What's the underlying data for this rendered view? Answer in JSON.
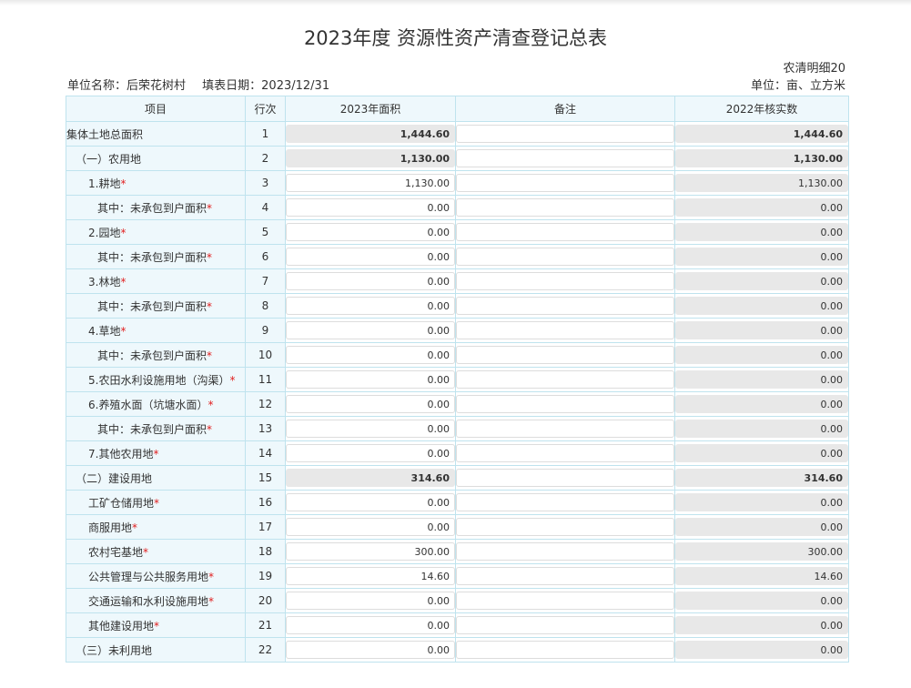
{
  "title": "2023年度 资源性资产清查登记总表",
  "meta": {
    "code": "农清明细20",
    "unit_name": "单位名称：后荣花树村",
    "fill_date": "填表日期：2023/12/31",
    "unit_measure": "单位：亩、立方米"
  },
  "headers": [
    "项目",
    "行次",
    "2023年面积",
    "备注",
    "2022年核实数"
  ],
  "rows": [
    {
      "item": "集体土地总面积",
      "req": "",
      "row": "1",
      "current": "1,444.60",
      "note": "",
      "prev": "1,444.60"
    },
    {
      "item": "（一）农用地",
      "req": "",
      "row": "2",
      "current": "1,130.00",
      "note": "",
      "prev": "1,130.00"
    },
    {
      "item": "1.耕地",
      "req": "*",
      "row": "3",
      "current": "1,130.00",
      "note": "",
      "prev": "1,130.00"
    },
    {
      "item": "其中：未承包到户面积",
      "req": "*",
      "row": "4",
      "current": "0.00",
      "note": "",
      "prev": "0.00"
    },
    {
      "item": "2.园地",
      "req": "*",
      "row": "5",
      "current": "0.00",
      "note": "",
      "prev": "0.00"
    },
    {
      "item": "其中：未承包到户面积",
      "req": "*",
      "row": "6",
      "current": "0.00",
      "note": "",
      "prev": "0.00"
    },
    {
      "item": "3.林地",
      "req": "*",
      "row": "7",
      "current": "0.00",
      "note": "",
      "prev": "0.00"
    },
    {
      "item": "其中：未承包到户面积",
      "req": "*",
      "row": "8",
      "current": "0.00",
      "note": "",
      "prev": "0.00"
    },
    {
      "item": "4.草地",
      "req": "*",
      "row": "9",
      "current": "0.00",
      "note": "",
      "prev": "0.00"
    },
    {
      "item": "其中：未承包到户面积",
      "req": "*",
      "row": "10",
      "current": "0.00",
      "note": "",
      "prev": "0.00"
    },
    {
      "item": "5.农田水利设施用地（沟渠）",
      "req": "*",
      "row": "11",
      "current": "0.00",
      "note": "",
      "prev": "0.00"
    },
    {
      "item": "6.养殖水面（坑塘水面）",
      "req": "*",
      "row": "12",
      "current": "0.00",
      "note": "",
      "prev": "0.00"
    },
    {
      "item": "其中：未承包到户面积",
      "req": "*",
      "row": "13",
      "current": "0.00",
      "note": "",
      "prev": "0.00"
    },
    {
      "item": "7.其他农用地",
      "req": "*",
      "row": "14",
      "current": "0.00",
      "note": "",
      "prev": "0.00"
    },
    {
      "item": "（二）建设用地",
      "req": "",
      "row": "15",
      "current": "314.60",
      "note": "",
      "prev": "314.60"
    },
    {
      "item": "工矿仓储用地",
      "req": "*",
      "row": "16",
      "current": "0.00",
      "note": "",
      "prev": "0.00"
    },
    {
      "item": "商服用地",
      "req": "*",
      "row": "17",
      "current": "0.00",
      "note": "",
      "prev": "0.00"
    },
    {
      "item": "农村宅基地",
      "req": "*",
      "row": "18",
      "current": "300.00",
      "note": "",
      "prev": "300.00"
    },
    {
      "item": "公共管理与公共服务用地",
      "req": "*",
      "row": "19",
      "current": "14.60",
      "note": "",
      "prev": "14.60"
    },
    {
      "item": "交通运输和水利设施用地",
      "req": "*",
      "row": "20",
      "current": "0.00",
      "note": "",
      "prev": "0.00"
    },
    {
      "item": "其他建设用地",
      "req": "*",
      "row": "21",
      "current": "0.00",
      "note": "",
      "prev": "0.00"
    },
    {
      "item": "（三）未利用地",
      "req": "",
      "row": "22",
      "current": "0.00",
      "note": "",
      "prev": "0.00"
    }
  ]
}
